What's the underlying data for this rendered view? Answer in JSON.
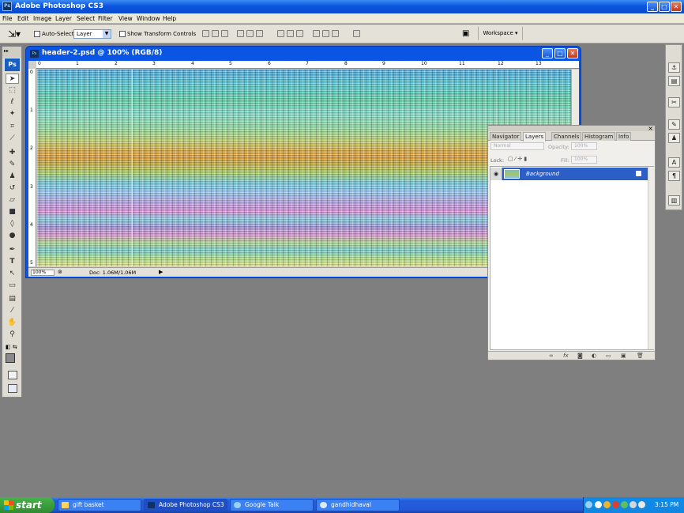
{
  "app": {
    "title": "Adobe Photoshop CS3",
    "icon_text": "Ps",
    "controls": {
      "minimize": "_",
      "maximize": "□",
      "close": "✕"
    }
  },
  "menu": [
    "File",
    "Edit",
    "Image",
    "Layer",
    "Select",
    "Filter",
    "View",
    "Window",
    "Help"
  ],
  "options_bar": {
    "auto_select_label": "Auto-Select:",
    "auto_select_value": "Layer",
    "show_transform_label": "Show Transform Controls",
    "workspace_label": "Workspace ▾"
  },
  "toolbox": {
    "logo": "Ps",
    "tools": [
      "move-tool-icon",
      "marquee-tool-icon",
      "lasso-tool-icon",
      "magic-wand-icon",
      "crop-tool-icon",
      "slice-tool-icon",
      "healing-brush-icon",
      "brush-tool-icon",
      "clone-stamp-icon",
      "history-brush-icon",
      "eraser-tool-icon",
      "gradient-tool-icon",
      "blur-tool-icon",
      "dodge-tool-icon",
      "pen-tool-icon",
      "type-tool-icon",
      "path-select-icon",
      "shape-tool-icon",
      "notes-tool-icon",
      "eyedropper-icon",
      "hand-tool-icon",
      "zoom-tool-icon"
    ]
  },
  "document": {
    "title": "header-2.psd @ 100% (RGB/8)",
    "ruler_top": [
      "0",
      "1",
      "2",
      "3",
      "4",
      "5",
      "6",
      "7",
      "8",
      "9",
      "10",
      "11",
      "12",
      "13"
    ],
    "ruler_left": [
      "0",
      "1",
      "2",
      "3",
      "4",
      "5"
    ],
    "zoom": "100%",
    "doc_info": "Doc: 1.06M/1.06M"
  },
  "layers_panel": {
    "tabs": [
      "Navigator",
      "Layers",
      "Channels",
      "Histogram",
      "Info"
    ],
    "active_tab": "Layers",
    "blend_mode": "Normal",
    "opacity_label": "Opacity:",
    "opacity_value": "100%",
    "lock_label": "Lock:",
    "fill_label": "Fill:",
    "fill_value": "100%",
    "layers": [
      {
        "name": "Background"
      }
    ]
  },
  "taskbar": {
    "start_label": "start",
    "tasks": [
      "gift basket",
      "Adobe Photoshop CS3",
      "Google Talk",
      "gandhidhaval"
    ],
    "active_task": "Adobe Photoshop CS3",
    "clock": "3:15 PM"
  },
  "colors": {
    "xp_blue": "#0b55e5",
    "selected_layer": "#2c5fc6",
    "workspace_gray": "#7f7f7f",
    "start_green": "#3d9c3d"
  }
}
